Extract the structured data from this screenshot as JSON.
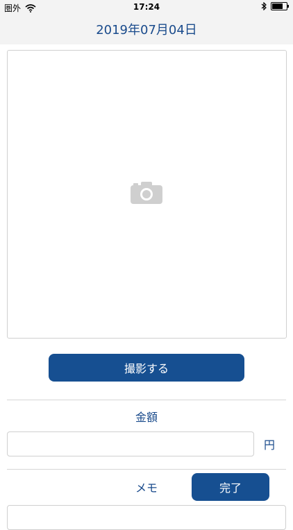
{
  "status_bar": {
    "carrier": "圏外",
    "time": "17:24",
    "icons": [
      "wifi-icon",
      "bluetooth-icon",
      "battery-icon"
    ],
    "battery_level": 0.7
  },
  "header": {
    "title": "2019年07月04日"
  },
  "photo": {
    "icon": "camera-icon"
  },
  "capture_button": {
    "label": "撮影する"
  },
  "amount": {
    "label": "金額",
    "value": "",
    "unit": "円"
  },
  "memo": {
    "label": "メモ",
    "value": ""
  },
  "done_button": {
    "label": "完了"
  },
  "colors": {
    "accent": "#164f91",
    "text_primary": "#1a4b8c",
    "header_bg": "#f3f3f3",
    "border": "#cfcfcf"
  }
}
